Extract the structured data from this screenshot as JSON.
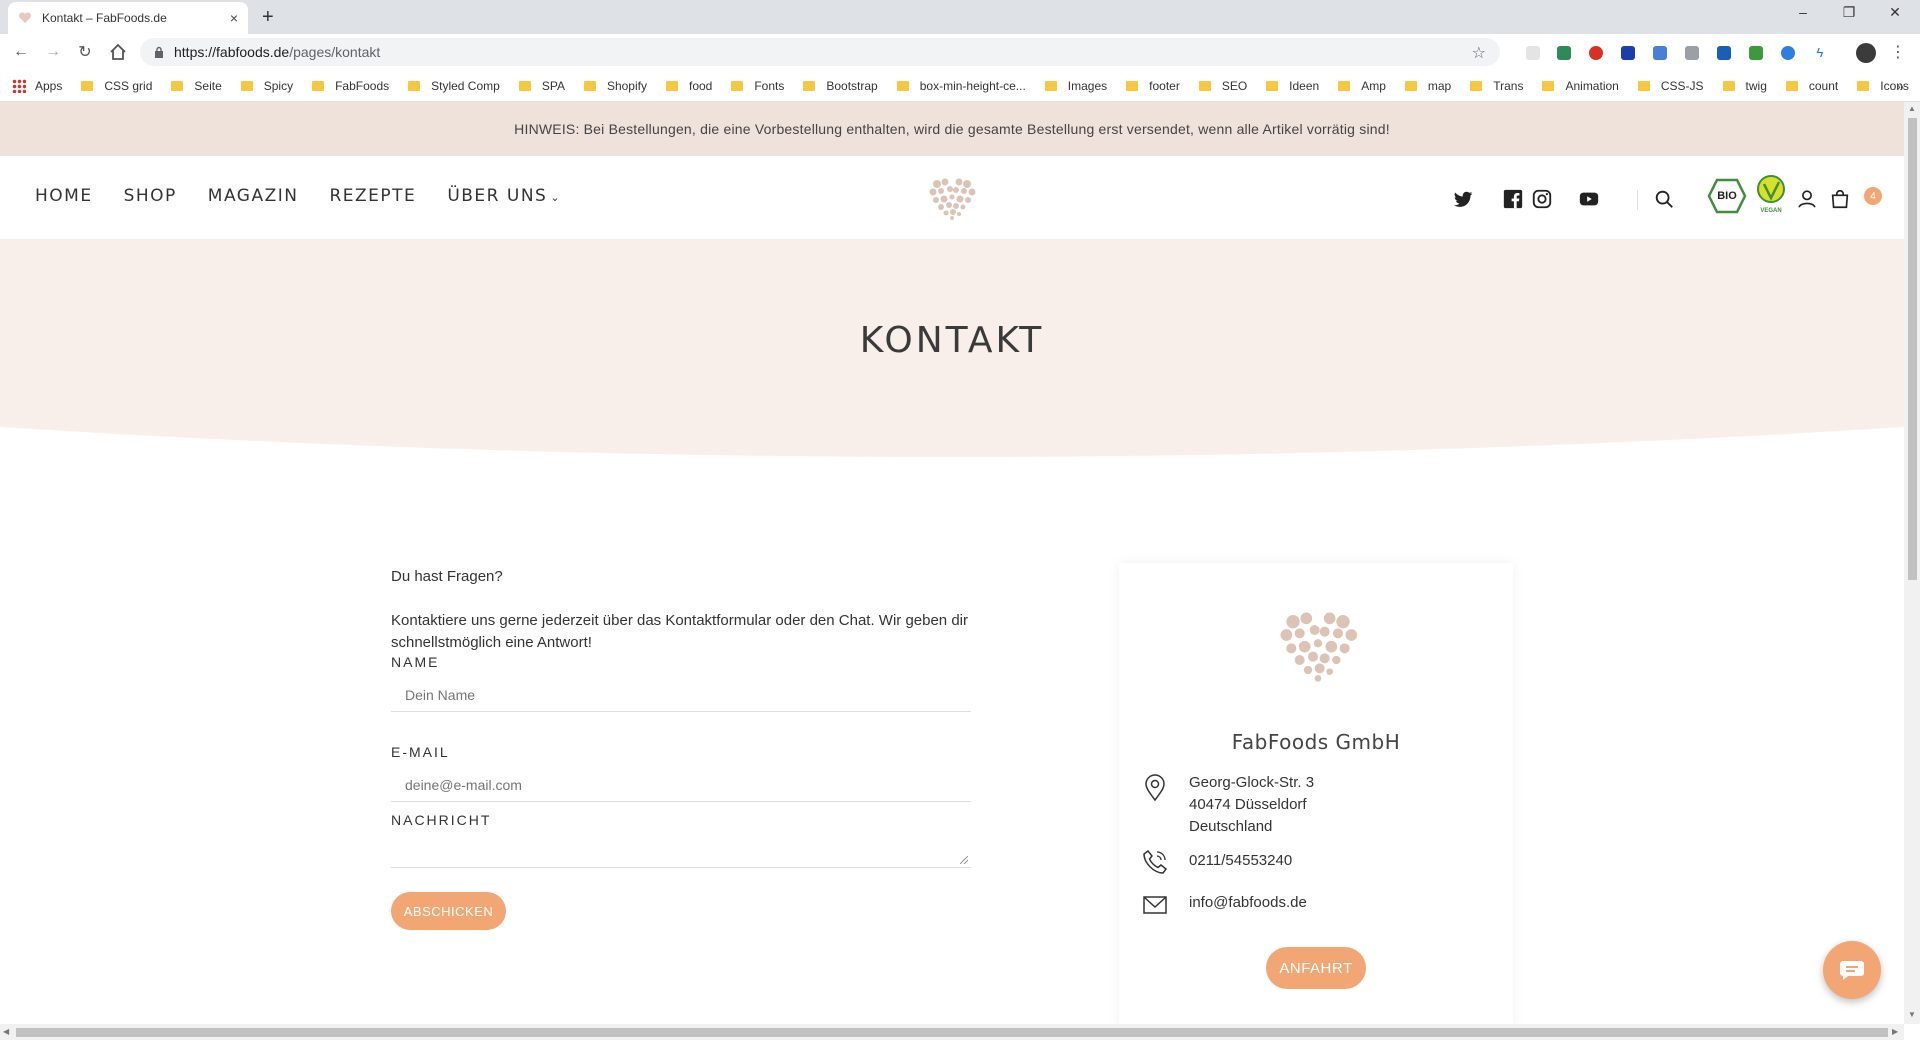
{
  "browser": {
    "tab_title": "Kontakt – FabFoods.de",
    "tab_close": "×",
    "new_tab": "+",
    "url_host": "https://fabfoods.de",
    "url_path": "/pages/kontakt",
    "bookmarks": [
      "CSS grid",
      "Seite",
      "Spicy",
      "FabFoods",
      "Styled Comp",
      "SPA",
      "Shopify",
      "food",
      "Fonts",
      "Bootstrap",
      "box-min-height-ce...",
      "Images",
      "footer",
      "SEO",
      "Ideen",
      "Amp",
      "map",
      "Trans",
      "Animation",
      "CSS-JS",
      "twig",
      "count",
      "Icons"
    ],
    "apps_label": "Apps",
    "more": "»"
  },
  "notice": {
    "text": "HINWEIS: Bei Bestellungen, die eine Vorbestellung enthalten, wird die gesamte Bestellung erst versendet, wenn alle Artikel vorrätig sind!"
  },
  "nav": {
    "items": [
      "HOME",
      "SHOP",
      "MAGAZIN",
      "REZEPTE",
      "ÜBER UNS"
    ],
    "dropdown_chevron": "⌄"
  },
  "header": {
    "cart_count": "4",
    "icons": [
      "twitter-icon",
      "facebook-icon",
      "instagram-icon",
      "youtube-icon",
      "search-icon",
      "bio-seal-icon",
      "vegan-seal-icon",
      "account-icon",
      "cart-icon"
    ]
  },
  "hero": {
    "title": "KONTAKT"
  },
  "form": {
    "question": "Du hast Fragen?",
    "intro": "Kontaktiere uns gerne jederzeit über das Kontaktformular oder den Chat. Wir geben dir schnellstmöglich eine Antwort!",
    "name_label": "NAME",
    "name_placeholder": "Dein Name",
    "email_label": "E-MAIL",
    "email_placeholder": "deine@e-mail.com",
    "message_label": "NACHRICHT",
    "submit_label": "ABSCHICKEN"
  },
  "company": {
    "name": "FabFoods GmbH",
    "street": "Georg-Glock-Str. 3",
    "city": "40474 Düsseldorf",
    "country": "Deutschland",
    "phone": "0211/54553240",
    "email": "info@fabfoods.de",
    "route_label": "ANFAHRT"
  },
  "colors": {
    "accent": "#f2a674",
    "notice_bg": "#efe2da",
    "hero_bg": "#f8efea"
  }
}
